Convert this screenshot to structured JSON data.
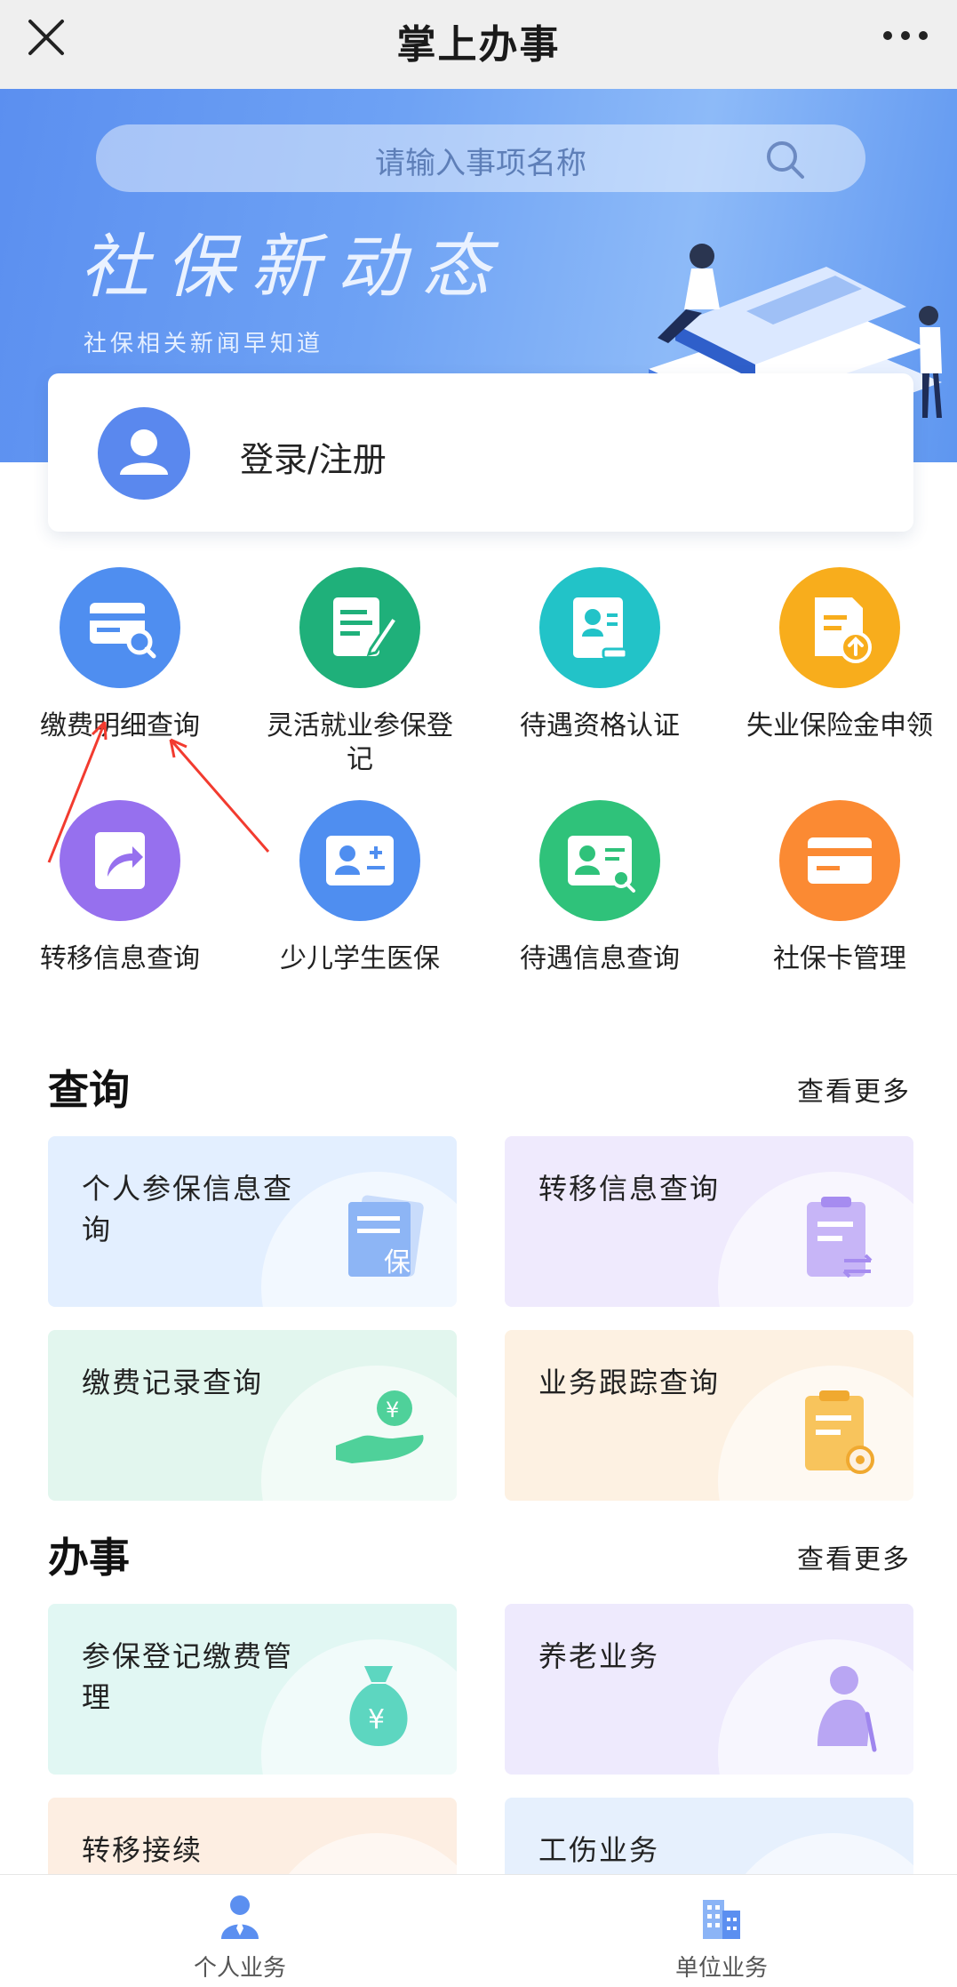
{
  "nav": {
    "title": "掌上办事"
  },
  "banner": {
    "search_placeholder": "请输入事项名称",
    "headline": "社保新动态",
    "subtitle": "社保相关新闻早知道"
  },
  "login": {
    "label": "登录/注册"
  },
  "services": [
    {
      "label": "缴费明细查询",
      "color": "#4f8ef0"
    },
    {
      "label": "灵活就业参保登记",
      "color": "#1fb07a"
    },
    {
      "label": "待遇资格认证",
      "color": "#22c3c8"
    },
    {
      "label": "失业保险金申领",
      "color": "#f8ad1c"
    },
    {
      "label": "转移信息查询",
      "color": "#9670ee"
    },
    {
      "label": "少儿学生医保",
      "color": "#4f8ef0"
    },
    {
      "label": "待遇信息查询",
      "color": "#2fc27a"
    },
    {
      "label": "社保卡管理",
      "color": "#fb8a33"
    }
  ],
  "query_section": {
    "title": "查询",
    "more": "查看更多",
    "cards": [
      {
        "label": "个人参保信息查询",
        "bg": "#e3efff",
        "icon": "insurance-doc-icon"
      },
      {
        "label": "转移信息查询",
        "bg": "#efeafd",
        "icon": "transfer-clipboard-icon"
      },
      {
        "label": "缴费记录查询",
        "bg": "#e2f6ee",
        "icon": "coin-hand-icon"
      },
      {
        "label": "业务跟踪查询",
        "bg": "#fdf1e2",
        "icon": "tracking-clipboard-icon"
      }
    ]
  },
  "handle_section": {
    "title": "办事",
    "more": "查看更多",
    "cards": [
      {
        "label": "参保登记缴费管理",
        "bg": "#e1f7f3",
        "icon": "money-bag-icon"
      },
      {
        "label": "养老业务",
        "bg": "#eeeafd",
        "icon": "elderly-icon"
      },
      {
        "label": "转移接续",
        "bg": "#fdeee2",
        "icon": "transfer-icon"
      },
      {
        "label": "工伤业务",
        "bg": "#e6f0fd",
        "icon": "injury-icon"
      }
    ]
  },
  "tabbar": {
    "tabs": [
      {
        "label": "个人业务",
        "icon": "person-icon"
      },
      {
        "label": "单位业务",
        "icon": "building-icon"
      }
    ]
  }
}
